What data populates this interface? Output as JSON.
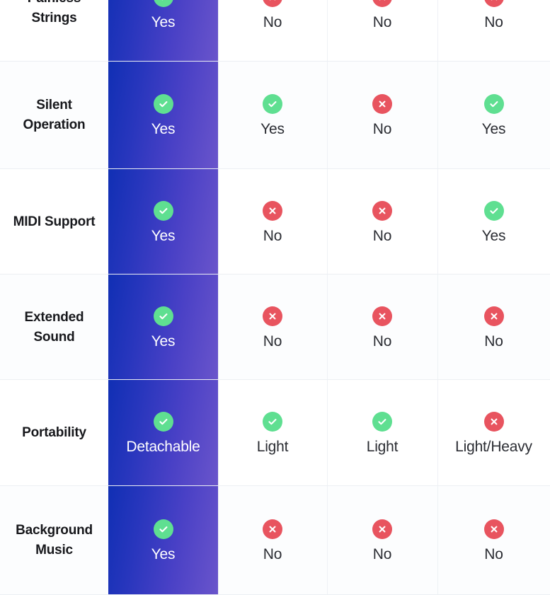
{
  "table": {
    "columns": [
      {
        "key": "feature",
        "type": "feature",
        "highlighted": false
      },
      {
        "key": "product_a",
        "type": "value",
        "highlighted": true
      },
      {
        "key": "product_b",
        "type": "value",
        "highlighted": false
      },
      {
        "key": "product_c",
        "type": "value",
        "highlighted": false
      },
      {
        "key": "product_d",
        "type": "value",
        "highlighted": false
      }
    ],
    "colors": {
      "highlight_gradient_start": "#102fb4",
      "highlight_gradient_end": "#6a55cb",
      "yes_icon": "#5fdf91",
      "no_icon": "#e8545f",
      "grid_line": "#eef1f5",
      "text": "#17181c",
      "value_text": "#2b2d33",
      "highlight_text": "#ffffff"
    },
    "icons": {
      "yes": "check-circle-icon",
      "no": "x-circle-icon"
    },
    "rows": [
      {
        "feature": "Painless Strings",
        "feature_lines": [
          "Painless",
          "Strings"
        ],
        "cells": [
          {
            "icon": "yes",
            "label": "Yes"
          },
          {
            "icon": "no",
            "label": "No"
          },
          {
            "icon": "no",
            "label": "No"
          },
          {
            "icon": "no",
            "label": "No"
          }
        ]
      },
      {
        "feature": "Silent Operation",
        "feature_lines": [
          "Silent",
          "Operation"
        ],
        "cells": [
          {
            "icon": "yes",
            "label": "Yes"
          },
          {
            "icon": "yes",
            "label": "Yes"
          },
          {
            "icon": "no",
            "label": "No"
          },
          {
            "icon": "yes",
            "label": "Yes"
          }
        ]
      },
      {
        "feature": "MIDI Support",
        "feature_lines": [
          "MIDI Support"
        ],
        "cells": [
          {
            "icon": "yes",
            "label": "Yes"
          },
          {
            "icon": "no",
            "label": "No"
          },
          {
            "icon": "no",
            "label": "No"
          },
          {
            "icon": "yes",
            "label": "Yes"
          }
        ]
      },
      {
        "feature": "Extended Sound",
        "feature_lines": [
          "Extended",
          "Sound"
        ],
        "cells": [
          {
            "icon": "yes",
            "label": "Yes"
          },
          {
            "icon": "no",
            "label": "No"
          },
          {
            "icon": "no",
            "label": "No"
          },
          {
            "icon": "no",
            "label": "No"
          }
        ]
      },
      {
        "feature": "Portability",
        "feature_lines": [
          "Portability"
        ],
        "cells": [
          {
            "icon": "yes",
            "label": "Detachable"
          },
          {
            "icon": "yes",
            "label": "Light"
          },
          {
            "icon": "yes",
            "label": "Light"
          },
          {
            "icon": "no",
            "label": "Light/Heavy"
          }
        ]
      },
      {
        "feature": "Background Music",
        "feature_lines": [
          "Background",
          "Music"
        ],
        "cells": [
          {
            "icon": "yes",
            "label": "Yes"
          },
          {
            "icon": "no",
            "label": "No"
          },
          {
            "icon": "no",
            "label": "No"
          },
          {
            "icon": "no",
            "label": "No"
          }
        ]
      }
    ]
  }
}
